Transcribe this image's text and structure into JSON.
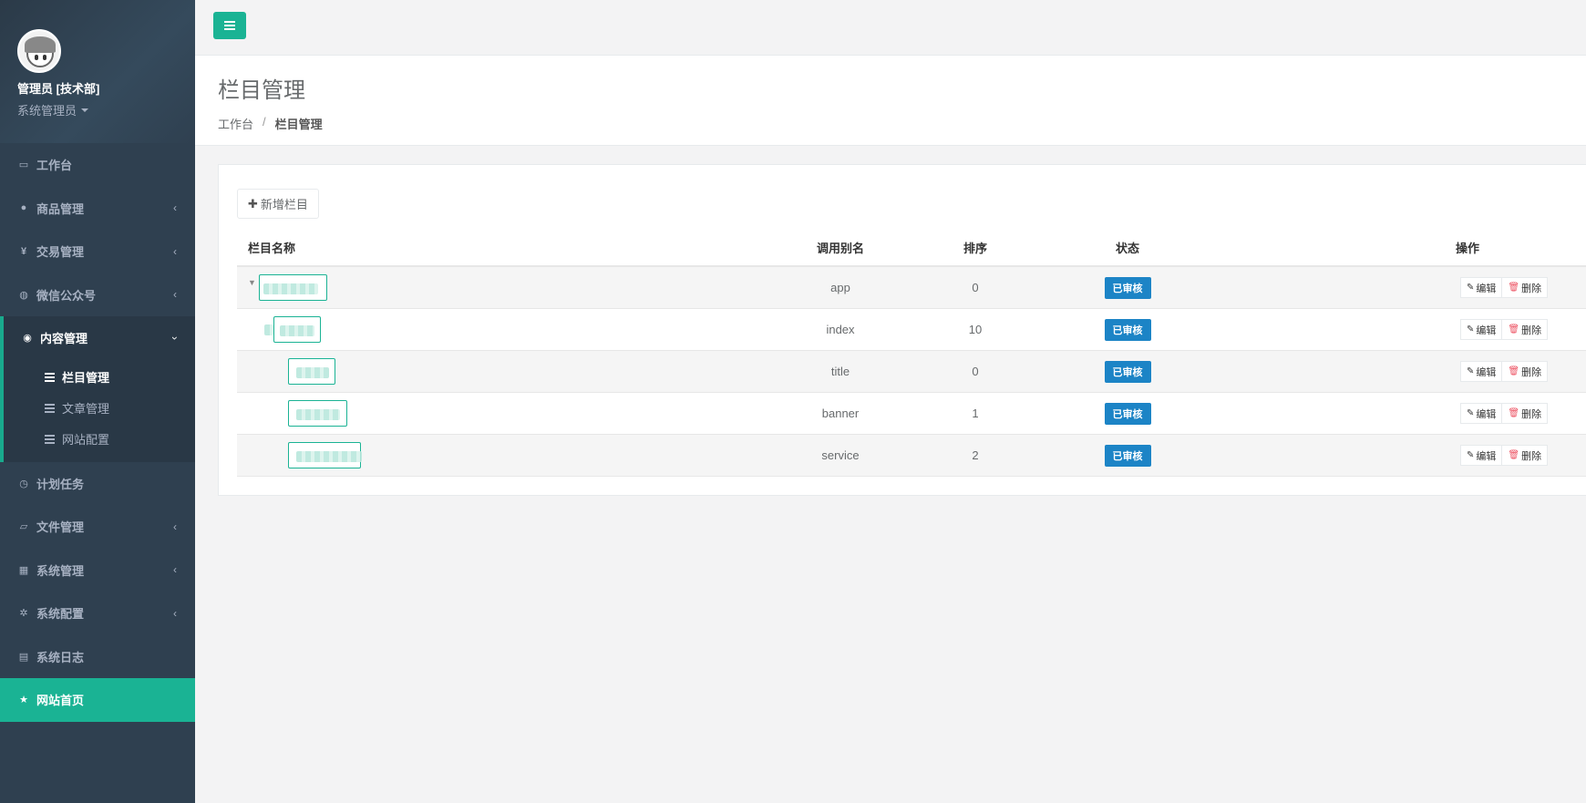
{
  "sidebar": {
    "profile": {
      "name": "管理员 [技术部]",
      "role": "系统管理员"
    },
    "items": [
      {
        "label": "工作台",
        "icon": "monitor-icon",
        "glyph": "▭"
      },
      {
        "label": "商品管理",
        "icon": "apple-icon",
        "glyph": "●",
        "arrow": "‹"
      },
      {
        "label": "交易管理",
        "icon": "yen-icon",
        "glyph": "¥",
        "arrow": "‹"
      },
      {
        "label": "微信公众号",
        "icon": "wechat-icon",
        "glyph": "◍",
        "arrow": "‹"
      },
      {
        "label": "内容管理",
        "icon": "chrome-icon",
        "glyph": "◉",
        "arrow": "›"
      }
    ],
    "subitems": [
      {
        "label": "栏目管理"
      },
      {
        "label": "文章管理"
      },
      {
        "label": "网站配置"
      }
    ],
    "items2": [
      {
        "label": "计划任务",
        "icon": "clock-icon",
        "glyph": "◷"
      },
      {
        "label": "文件管理",
        "icon": "folder-icon",
        "glyph": "▱",
        "arrow": "‹"
      },
      {
        "label": "系统管理",
        "icon": "windows-icon",
        "glyph": "▦",
        "arrow": "‹"
      },
      {
        "label": "系统配置",
        "icon": "gear-icon",
        "glyph": "✲",
        "arrow": "‹"
      },
      {
        "label": "系统日志",
        "icon": "file-icon",
        "glyph": "▤"
      }
    ],
    "home": {
      "label": "网站首页",
      "icon": "star-icon",
      "glyph": "★"
    }
  },
  "heading": {
    "title": "栏目管理",
    "breadcrumb": [
      "工作台",
      "/",
      "栏目管理"
    ]
  },
  "toolbar": {
    "add_label": "新增栏目"
  },
  "table": {
    "headers": {
      "name": "栏目名称",
      "alias": "调用别名",
      "order": "排序",
      "status": "状态",
      "ops": "操作"
    },
    "rows": [
      {
        "alias": "app",
        "order": "0",
        "status": "已审核"
      },
      {
        "alias": "index",
        "order": "10",
        "status": "已审核"
      },
      {
        "alias": "title",
        "order": "0",
        "status": "已审核"
      },
      {
        "alias": "banner",
        "order": "1",
        "status": "已审核"
      },
      {
        "alias": "service",
        "order": "2",
        "status": "已审核"
      }
    ],
    "edit_label": "编辑",
    "delete_label": "删除"
  },
  "colors": {
    "sidebar": "#2f4050",
    "accent": "#1ab394",
    "badge": "#1c84c6"
  }
}
